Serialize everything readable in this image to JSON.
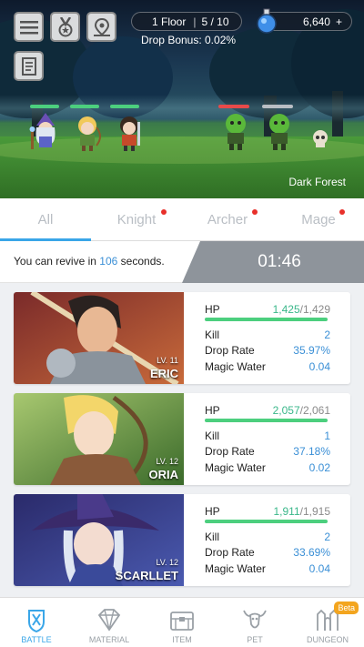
{
  "hud": {
    "floor": "1 Floor",
    "wave": "5 / 10",
    "drop_bonus": "Drop Bonus: 0.02%",
    "gold": "6,640",
    "gold_add": "+",
    "location": "Dark Forest"
  },
  "tabs": [
    {
      "label": "All",
      "active": true,
      "dot": false
    },
    {
      "label": "Knight",
      "active": false,
      "dot": true
    },
    {
      "label": "Archer",
      "active": false,
      "dot": true
    },
    {
      "label": "Mage",
      "active": false,
      "dot": true
    }
  ],
  "revive": {
    "prefix": "You can revive in",
    "seconds": "106",
    "suffix": "seconds.",
    "timer": "01:46"
  },
  "labels": {
    "hp": "HP",
    "kill": "Kill",
    "drop_rate": "Drop Rate",
    "magic_water": "Magic Water"
  },
  "heroes": [
    {
      "level": "LV. 11",
      "name": "ERIC",
      "hp_current": "1,425",
      "hp_max": "1,429",
      "hp_sep": "/",
      "hp_fraction": 0.997,
      "kill": "2",
      "drop_rate": "35.97%",
      "magic_water": "0.04"
    },
    {
      "level": "LV. 12",
      "name": "ORIA",
      "hp_current": "2,057",
      "hp_max": "2,061",
      "hp_sep": "/",
      "hp_fraction": 0.998,
      "kill": "1",
      "drop_rate": "37.18%",
      "magic_water": "0.02"
    },
    {
      "level": "LV. 12",
      "name": "SCARLLET",
      "hp_current": "1,911",
      "hp_max": "1,915",
      "hp_sep": "/",
      "hp_fraction": 0.998,
      "kill": "2",
      "drop_rate": "33.69%",
      "magic_water": "0.04"
    }
  ],
  "nav": [
    {
      "label": "BATTLE",
      "icon": "battle-icon",
      "active": true
    },
    {
      "label": "MATERIAL",
      "icon": "diamond-icon",
      "active": false
    },
    {
      "label": "ITEM",
      "icon": "chest-icon",
      "active": false
    },
    {
      "label": "PET",
      "icon": "bull-icon",
      "active": false
    },
    {
      "label": "DUNGEON",
      "icon": "gate-icon",
      "active": false,
      "badge": "Beta"
    }
  ],
  "colors": {
    "accent": "#3aa6e8",
    "hp_green": "#4ccf7e",
    "value_blue": "#3a8fd6",
    "notify_red": "#e8302a",
    "beta_orange": "#f3a51f"
  }
}
